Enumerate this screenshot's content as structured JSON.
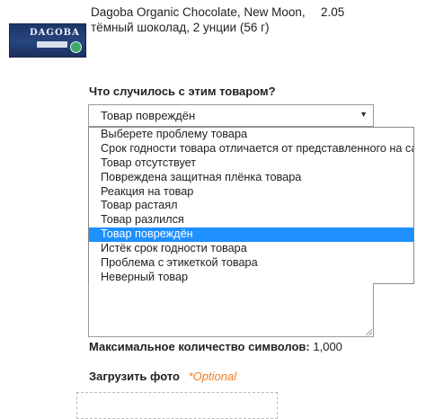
{
  "product": {
    "name": "Dagoba Organic Chocolate, New Moon, тёмный шоколад, 2 унции (56 г)",
    "price": "2.05",
    "image_brand_text": "DAGOBA"
  },
  "question": {
    "label": "Что случилось с этим товаром?",
    "selected_value": "Товар повреждён",
    "options": [
      "Выберете проблему товара",
      "Срок годности товара отличается от представленного на сайте",
      "Товар отсутствует",
      "Повреждена защитная плёнка товара",
      "Реакция на товар",
      "Товар растаял",
      "Товар разлился",
      "Товар повреждён",
      "Истёк срок годности товара",
      "Проблема с этикеткой товара",
      "Неверный товар"
    ],
    "highlighted_index": 7
  },
  "comment": {
    "max_chars_label": "Максимальное количество символов:",
    "max_chars_value": "1,000"
  },
  "upload": {
    "label": "Загрузить фото",
    "optional": "*Optional"
  },
  "colors": {
    "highlight": "#1e90ff",
    "optional_accent": "#f07b1f"
  },
  "icons": {
    "select_arrow": "chevron-down-icon"
  }
}
